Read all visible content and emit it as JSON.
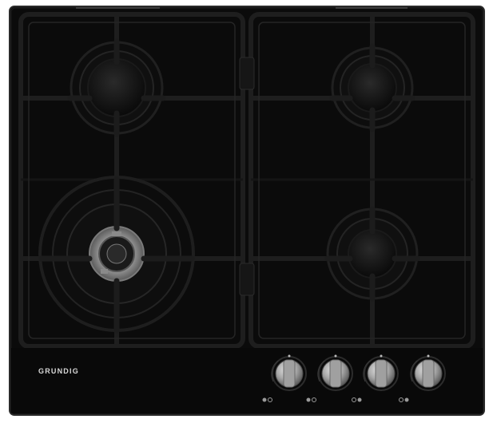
{
  "product": {
    "brand_label": "GRUNDIG"
  },
  "colors": {
    "background": "#ffffff",
    "glass": "#0b0b0b",
    "glass_edge": "#2a2a2a",
    "grate": "#161616",
    "burner": "#0e0e0e",
    "knob": "#b9b9b9",
    "brand_text": "#d9d9d9"
  },
  "icons": {
    "burners": [
      "burner-icon",
      "burner-icon",
      "burner-icon",
      "burner-icon"
    ],
    "knobs": [
      "control-knob-icon",
      "control-knob-icon",
      "control-knob-icon",
      "control-knob-icon"
    ]
  }
}
